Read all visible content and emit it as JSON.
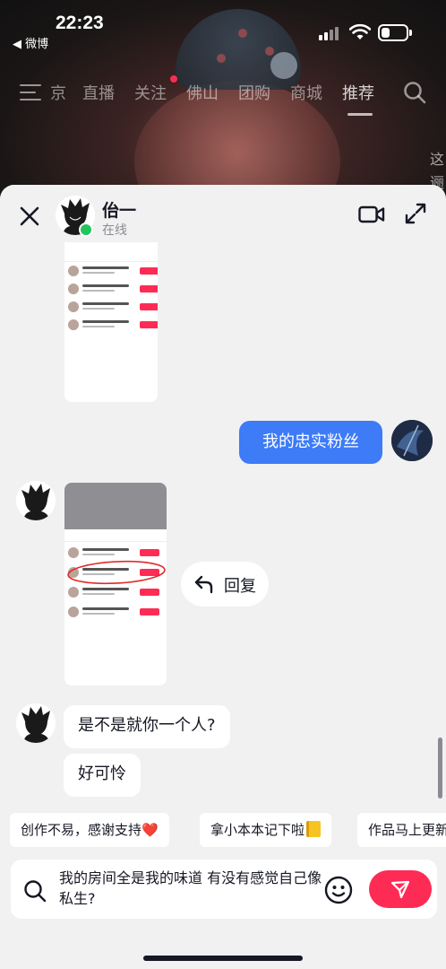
{
  "status_bar": {
    "time": "22:23",
    "back_app": "◀ 微博",
    "icons": [
      "signal-icon",
      "wifi-icon",
      "battery-icon"
    ]
  },
  "top_nav": {
    "items": [
      "京",
      "直播",
      "关注",
      "佛山",
      "团购",
      "商城",
      "推荐"
    ],
    "active": "推荐",
    "edge_text": [
      "这",
      "逦"
    ],
    "icons": [
      "menu-icon",
      "search-icon"
    ]
  },
  "chat": {
    "name": "佁一",
    "status": "在线",
    "icons": [
      "close-icon",
      "video-call-icon",
      "expand-icon"
    ]
  },
  "messages": {
    "my_message": "我的忠实粉丝",
    "reply_label": "回复",
    "bubble_1": "是不是就你一个人?",
    "bubble_2": "好可怜"
  },
  "quick_replies": {
    "chip_1": "创作不易，感谢支持",
    "chip_1_emoji": "❤️",
    "chip_2": "拿小本本记下啦",
    "chip_3": "作品马上更新"
  },
  "composer": {
    "value": "我的房间全是我的味道 有没有感觉自己像私生?",
    "icons": [
      "search-icon",
      "emoji-icon",
      "send-icon"
    ]
  },
  "colors": {
    "accent_red": "#fe2c55",
    "bubble_blue": "#3d7bf7",
    "online_green": "#22c55e",
    "sheet_bg": "#f1f1f2"
  }
}
